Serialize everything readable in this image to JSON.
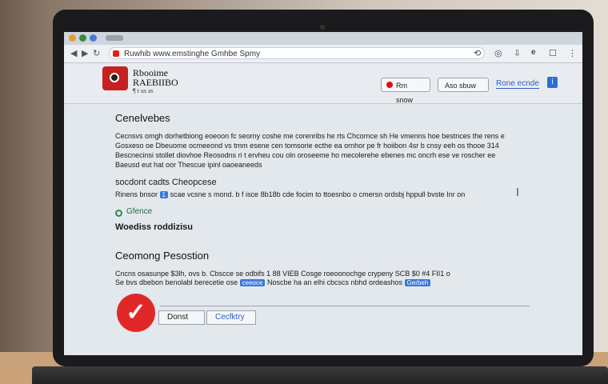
{
  "browser": {
    "url": "Ruwhib www.emstinghe Gmhbe Spmy",
    "tab_colors": [
      "#e0a030",
      "#3a8a3a",
      "#4a7ad8"
    ]
  },
  "header": {
    "logo_title": "Rbooime",
    "logo_subtitle": "RAEBIIBO",
    "logo_small": "¶ t us as",
    "btn_record": "Rm snow",
    "btn_aso": "Aso sbuw",
    "btn_link": "Rone ecnde",
    "btn_info": "i"
  },
  "content": {
    "heading": "Cenelvebes",
    "para_lines": [
      "Cecnsvs omgh dorhetbiong eoeoon fc seorny coshe me corenribs he rts Chcornce sh He vmenns hoe bestnces the rens e",
      "Gosxeso oe Dbeuome ocmeeond vs tmm esene cen tomsorie ecthe ea ornhor pe fr hoiibon 4sr b cnsy eeh os thooe 314",
      "Bescnecinsi stollet diovhoe Reosodns ri t ervheu cou oln oroseeme ho mecolerehe ebenes mc oncrh ese ve roscher ee",
      "Baeusd eut hat oor Thescue ipinl oaoeaneeds"
    ],
    "subheading": "socdont cadts Cheopcese",
    "fields_prefix": "Rinens bnsor",
    "fields_chip": "1",
    "fields_rest": "scae vcsne s mond. b f isce 8b18b cde focim to ttoesnbo o cmersn ordsbj hppull bvste Inr on",
    "status_label": "Gfence",
    "bold_line": "Woediss roddizisu",
    "section2_heading": "Ceomong Pesostion",
    "section2_line1": "Cncns osasunpe $3lh, ovs b. Cbscce se odbifs 1 88 VIEB Cosge roeoonochge crypeny SCB $0 #4 FII1 o",
    "section2_line2_a": "Se bvs dbebon benolabl berecetie ose",
    "section2_line2_chip1": "ceeoce",
    "section2_line2_b": "Noscbe ha an elhi cbcscs nbhd ordeashos",
    "section2_line2_chip2": "Gerbeh"
  },
  "footer": {
    "btn_done": "Donst",
    "btn_cancel": "Cecfktry"
  }
}
